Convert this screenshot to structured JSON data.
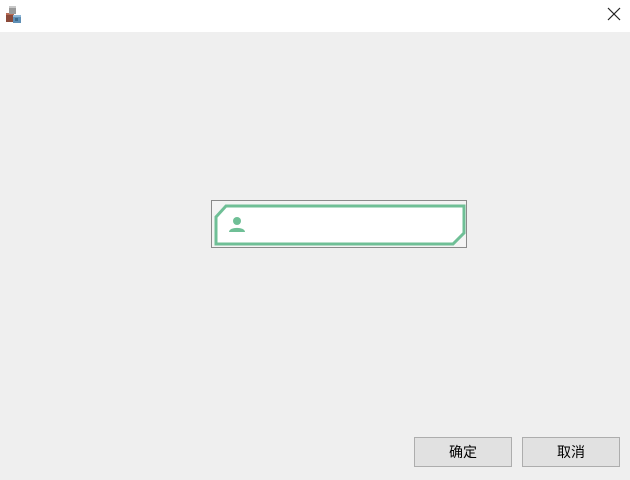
{
  "window": {
    "app_icon": "app-blocks-icon",
    "close_icon": "close-icon"
  },
  "form": {
    "user_field": {
      "icon": "user-icon",
      "value": "",
      "placeholder": "",
      "accent_color": "#6fbf96"
    }
  },
  "buttons": {
    "ok_label": "确定",
    "cancel_label": "取消"
  }
}
